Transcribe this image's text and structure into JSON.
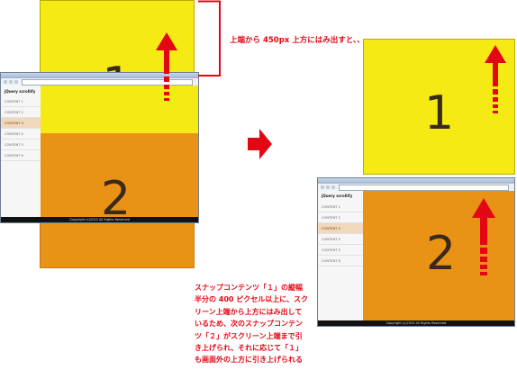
{
  "left_scene": {
    "panel1_label": "1",
    "panel2_label": "2",
    "browser": {
      "nav_title": "jQuery scrollify",
      "nav_items": [
        "CONTENT 1",
        "CONTENT 2",
        "CONTENT 3",
        "CONTENT 4",
        "CONTENT 5",
        "CONTENT 6"
      ],
      "active_index": 2,
      "footer_text": "Copyright (c)2015 All Rights Reserved"
    }
  },
  "right_scene": {
    "panel1_label": "1",
    "panel2_label": "2",
    "browser": {
      "nav_title": "jQuery scrollify",
      "nav_items": [
        "CONTENT 1",
        "CONTENT 2",
        "CONTENT 3",
        "CONTENT 4",
        "CONTENT 5",
        "CONTENT 6"
      ],
      "active_index": 2,
      "footer_text": "Copyright (c)2015 All Rights Reserved"
    }
  },
  "annotations": {
    "top_note": "上端から 450px 上方にはみ出すと、、",
    "bottom_note": [
      "スナップコンテンツ「１」の縦幅",
      "半分の 400 ピクセル以上に、スク",
      "リーン上端から上方にはみ出して",
      "いるため、次のスナップコンテン",
      "ツ「２」がスクリーン上端まで引",
      "き上げられ、それに応じて「１」",
      "も画面外の上方に引き上げられる"
    ]
  },
  "colors": {
    "accent_red": "#e30613",
    "panel_yellow": "#f5ea14",
    "panel_orange": "#e99316"
  }
}
